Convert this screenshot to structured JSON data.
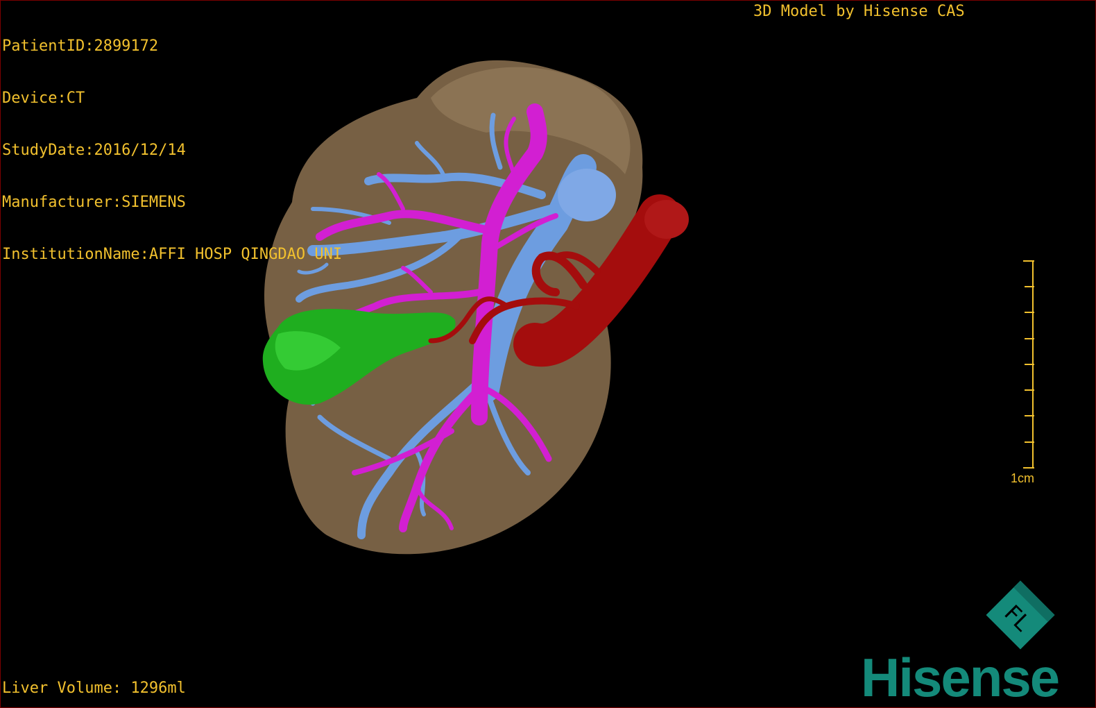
{
  "header": {
    "patient_id": "PatientID:2899172",
    "device": "Device:CT",
    "study_date": "StudyDate:2016/12/14",
    "manufacturer": "Manufacturer:SIEMENS",
    "institution": "InstitutionName:AFFI HOSP QINGDAO UNI",
    "title": "3D Model by Hisense CAS"
  },
  "footer": {
    "liver_volume": "Liver Volume: 1296ml"
  },
  "scale_bar": {
    "label": "1cm"
  },
  "brand": {
    "name": "Hisense",
    "logo_letters": "FL",
    "color": "#148a7a"
  },
  "model_colors": {
    "liver": "#7d6548",
    "portal_vein": "#d21fd2",
    "hepatic_vein": "#6d9de0",
    "artery": "#a40d0d",
    "gallbladder": "#1fae1f"
  }
}
